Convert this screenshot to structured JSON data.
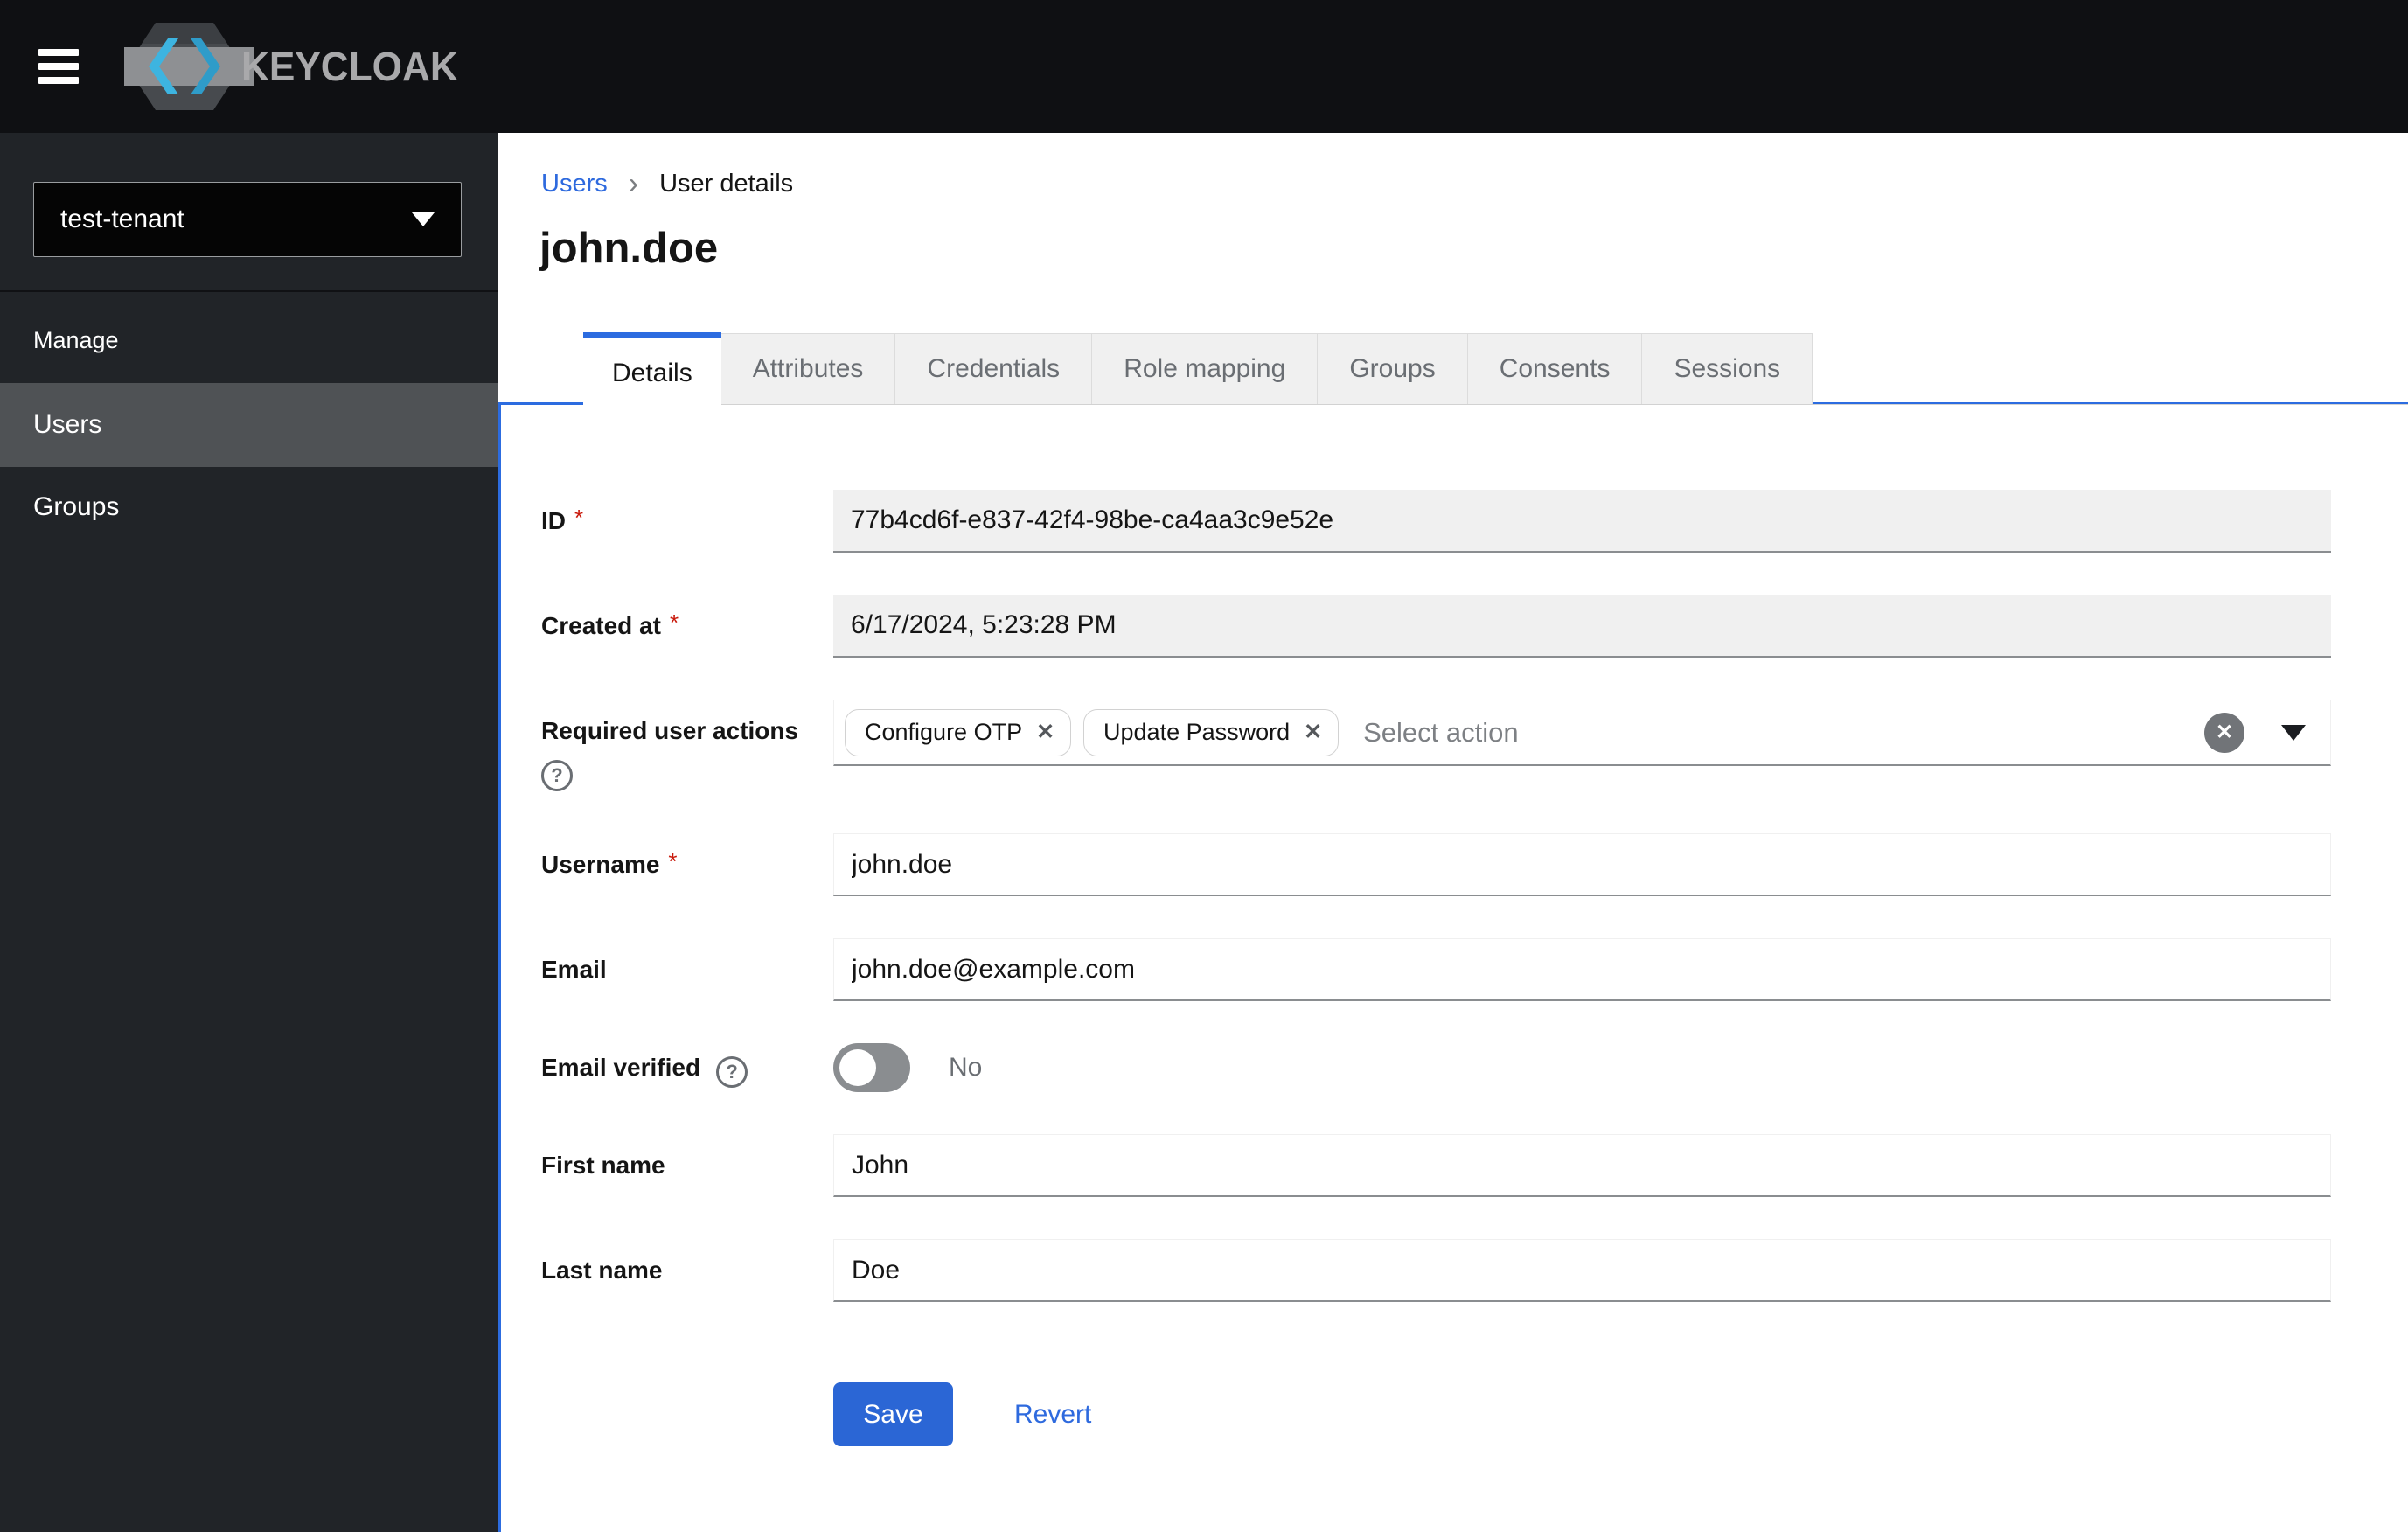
{
  "header": {
    "brand": "KEYCLOAK"
  },
  "sidebar": {
    "tenant": {
      "value": "test-tenant"
    },
    "section_label": "Manage",
    "items": [
      {
        "label": "Users",
        "active": true
      },
      {
        "label": "Groups",
        "active": false
      }
    ]
  },
  "breadcrumb": {
    "link": "Users",
    "separator": "›",
    "current": "User details"
  },
  "page": {
    "title": "john.doe"
  },
  "tabs": [
    {
      "label": "Details",
      "active": true
    },
    {
      "label": "Attributes",
      "active": false
    },
    {
      "label": "Credentials",
      "active": false
    },
    {
      "label": "Role mapping",
      "active": false
    },
    {
      "label": "Groups",
      "active": false
    },
    {
      "label": "Consents",
      "active": false
    },
    {
      "label": "Sessions",
      "active": false
    }
  ],
  "form": {
    "fields": {
      "id": {
        "label": "ID",
        "required": "*",
        "value": "77b4cd6f-e837-42f4-98be-ca4aa3c9e52e",
        "readonly": true
      },
      "created_at": {
        "label": "Created at",
        "required": "*",
        "value": "6/17/2024, 5:23:28 PM",
        "readonly": true
      },
      "required_user_actions": {
        "label": "Required user actions",
        "chips": [
          "Configure OTP",
          "Update Password"
        ],
        "placeholder": "Select action"
      },
      "username": {
        "label": "Username",
        "required": "*",
        "value": "john.doe"
      },
      "email": {
        "label": "Email",
        "value": "john.doe@example.com"
      },
      "email_verified": {
        "label": "Email verified",
        "state": "No",
        "enabled": false
      },
      "first_name": {
        "label": "First name",
        "value": "John"
      },
      "last_name": {
        "label": "Last name",
        "value": "Doe"
      }
    },
    "actions": {
      "save": "Save",
      "revert": "Revert"
    }
  },
  "icons": {
    "chip_remove": "✕",
    "clear_all": "✕",
    "help": "?"
  },
  "colors": {
    "accent_blue": "#2c6ce0",
    "button_blue": "#2b66d5",
    "link_blue": "#2e6ade",
    "header_bg": "#0f1013",
    "sidebar_bg": "#212428",
    "sidebar_active_bg": "#4f5255",
    "disabled_input_bg": "#f0f0f0",
    "input_bottom_border": "#8a8d90",
    "required_red": "#c9190b",
    "muted_text": "#6a6e73"
  }
}
